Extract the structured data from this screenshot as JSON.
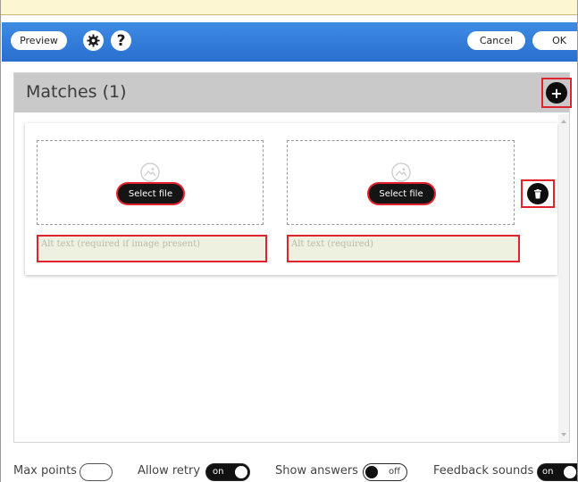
{
  "toolbar": {
    "preview_label": "Preview",
    "settings_icon": "gear-icon",
    "help_label": "?",
    "cancel_label": "Cancel",
    "ok_label": "OK",
    "color": "#2f7bd8"
  },
  "panel": {
    "title": "Matches (1)",
    "add_icon": "plus-icon",
    "match": {
      "left": {
        "image_icon": "image-icon",
        "select_label": "Select file",
        "alt_placeholder": "Alt text (required if image present)"
      },
      "right": {
        "image_icon": "image-icon",
        "select_label": "Select file",
        "alt_placeholder": "Alt text (required)"
      },
      "delete_icon": "trash-icon"
    }
  },
  "footer": {
    "max_points_label": "Max points",
    "max_points_value": "",
    "allow_retry_label": "Allow retry",
    "allow_retry_state": "on",
    "show_answers_label": "Show answers",
    "show_answers_state": "off",
    "feedback_sounds_label": "Feedback sounds",
    "feedback_sounds_state": "on"
  },
  "colors": {
    "highlight": "#e0232d",
    "header": "#c9c9c9",
    "alt_fill": "#eef1e0"
  }
}
